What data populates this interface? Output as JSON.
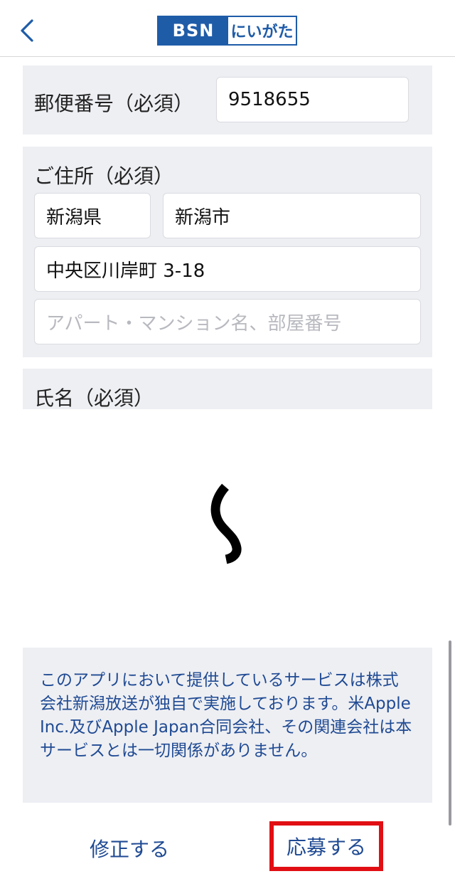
{
  "header": {
    "back_icon": "chevron-left-icon",
    "logo_left": "BSN",
    "logo_right": "にいがた",
    "accent_color": "#1f5ca8"
  },
  "postal": {
    "label": "郵便番号（必須）",
    "value": "9518655"
  },
  "address": {
    "label": "ご住所（必須）",
    "prefecture": "新潟県",
    "city": "新潟市",
    "street": "中央区川岸町 3-18",
    "building_placeholder": "アパート・マンション名、部屋番号"
  },
  "name_section": {
    "label": "氏名（必須）"
  },
  "loading": {
    "icon": "loading-spinner-icon"
  },
  "notice": {
    "text": "このアプリにおいて提供しているサービスは株式会社新潟放送が独自で実施しております。米Apple Inc.及びApple Japan合同会社、その関連会社は本サービスとは一切関係がありません。"
  },
  "actions": {
    "edit_label": "修正する",
    "apply_label": "応募する",
    "highlight_color": "#e10f14"
  }
}
